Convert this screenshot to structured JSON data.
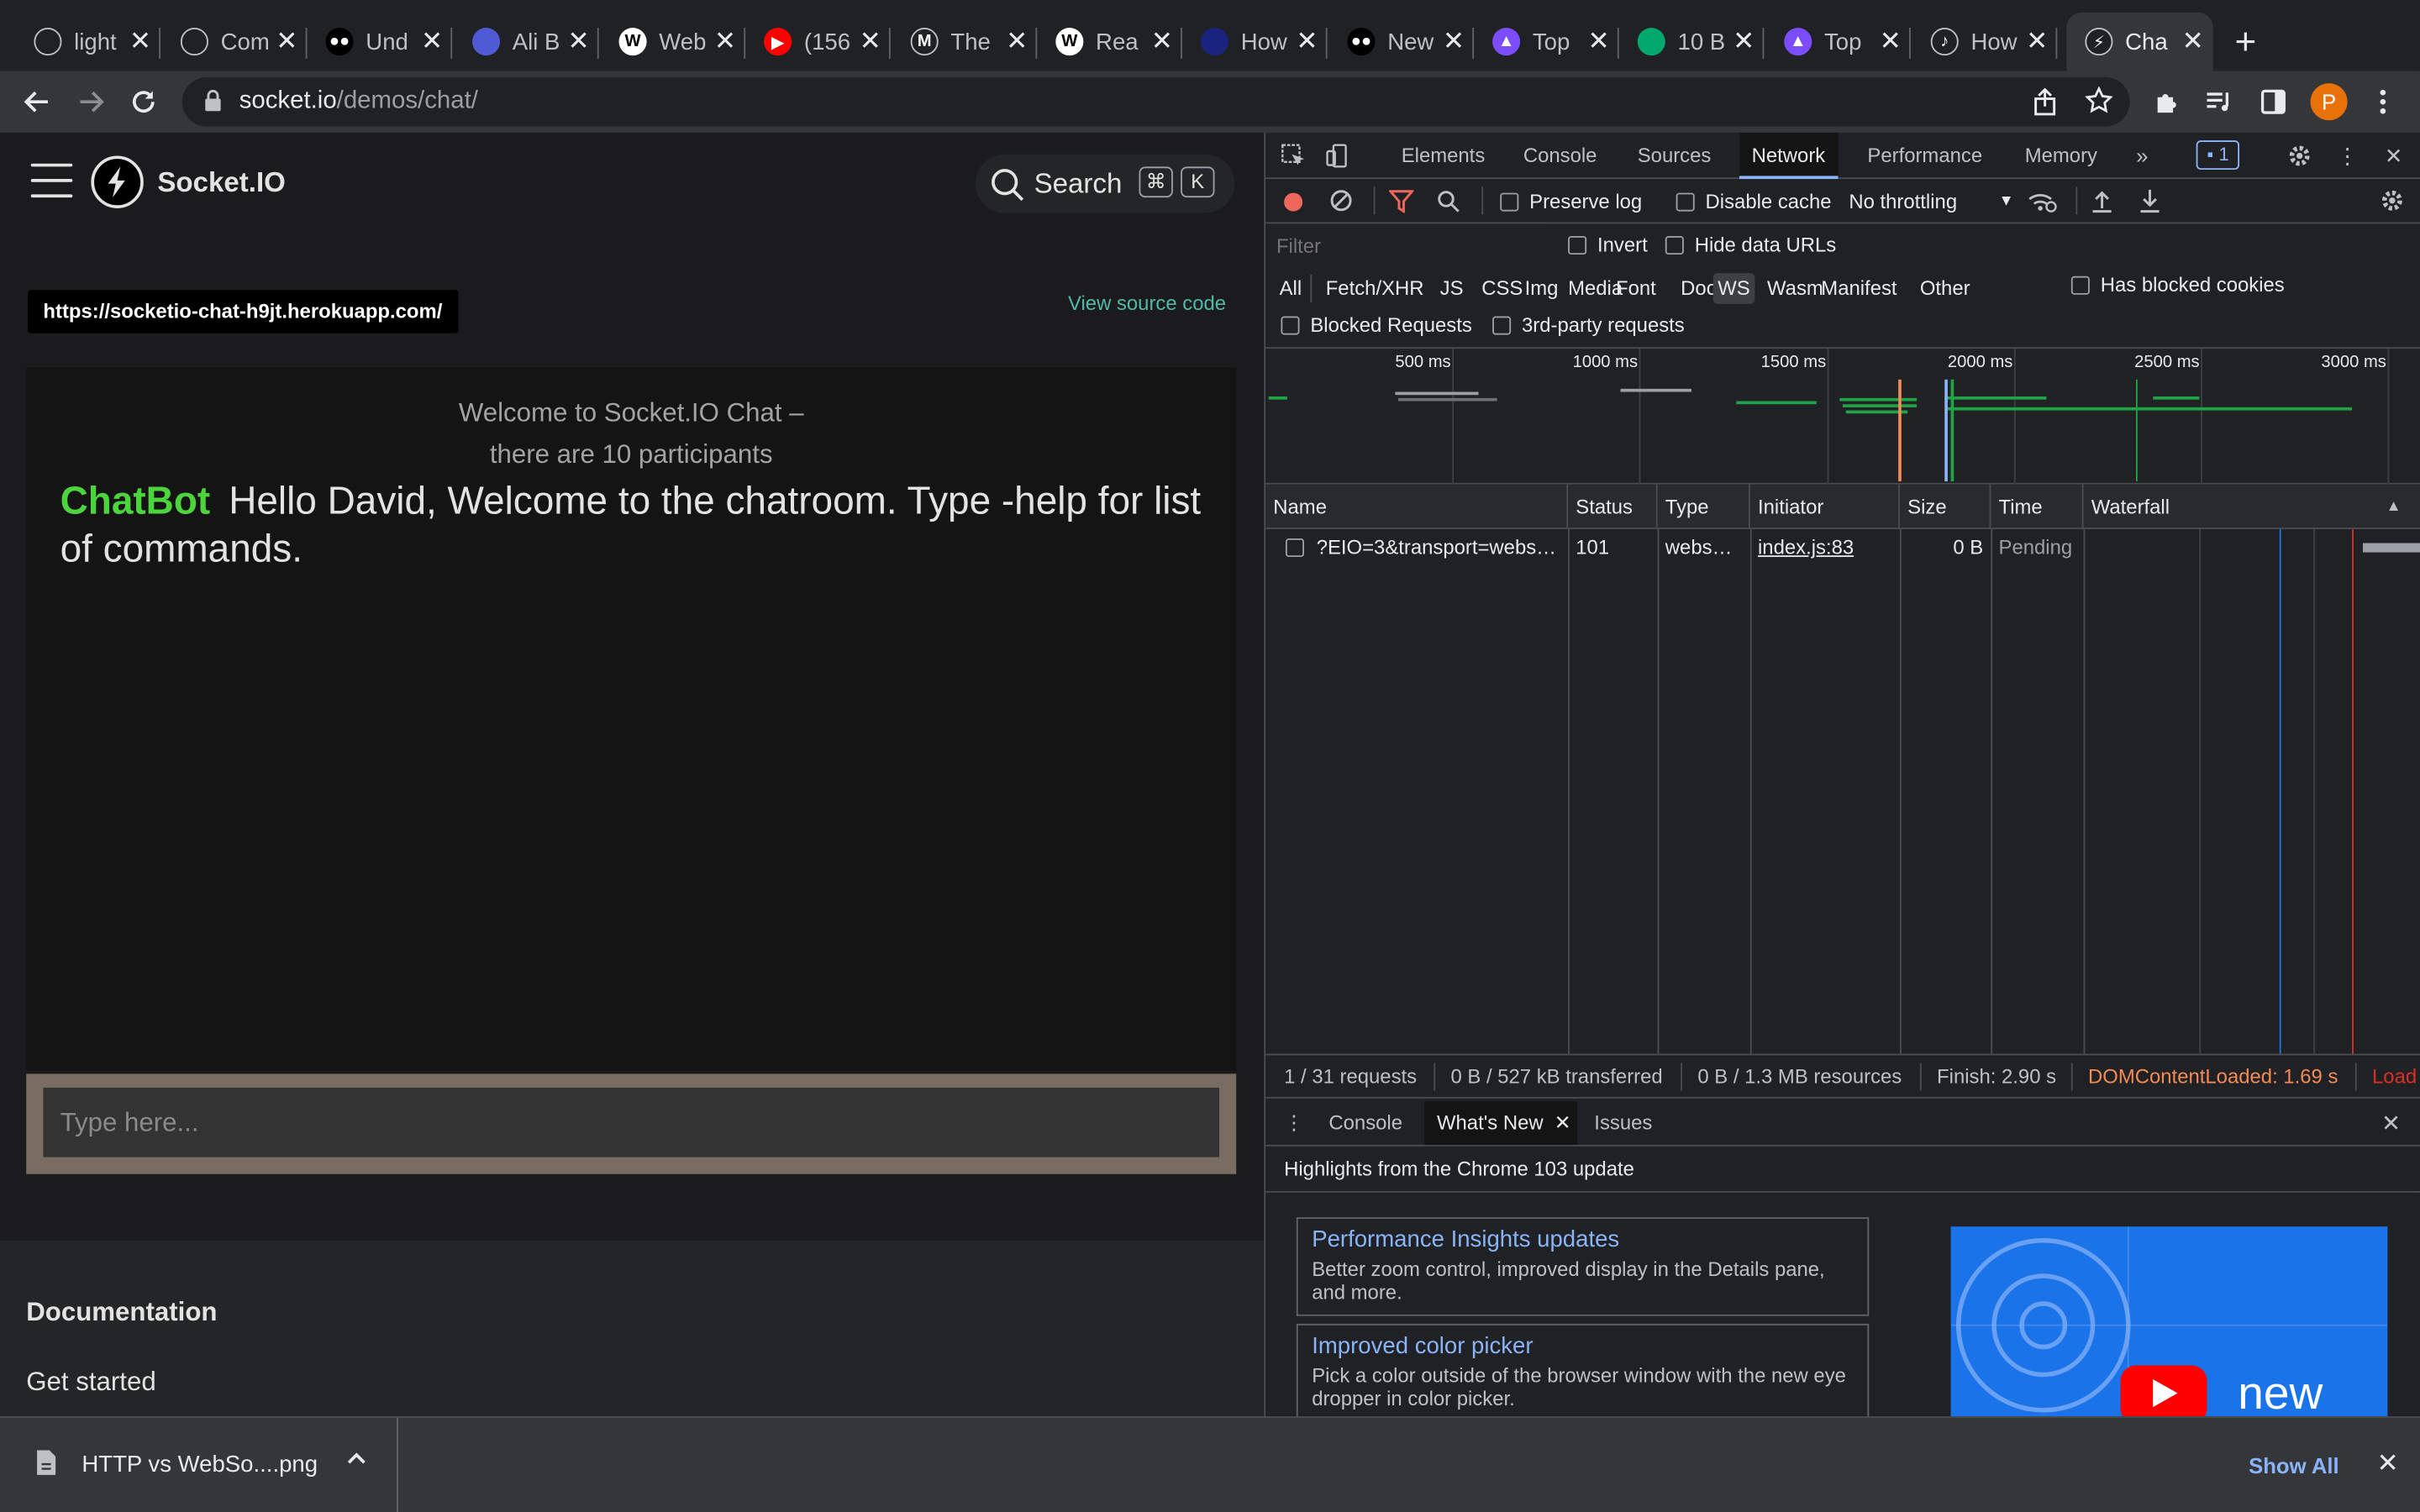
{
  "browser": {
    "tabs": [
      {
        "title": "light",
        "icon": "github-icon",
        "color": "#202124",
        "glyph": ""
      },
      {
        "title": "Com",
        "icon": "compass-icon",
        "color": "#202124",
        "glyph": ""
      },
      {
        "title": "Und",
        "icon": "medium-icon",
        "color": "#000000",
        "glyph": "●●"
      },
      {
        "title": "Ali B",
        "icon": "alibaba-icon",
        "color": "#4f5bd5",
        "glyph": ""
      },
      {
        "title": "Web",
        "icon": "wikipedia-icon",
        "color": "#ffffff",
        "glyph": "W"
      },
      {
        "title": "(156",
        "icon": "youtube-icon",
        "color": "#ff0000",
        "glyph": "▶"
      },
      {
        "title": "The",
        "icon": "m-logo-icon",
        "color": "#202124",
        "glyph": "M"
      },
      {
        "title": "Rea",
        "icon": "wikipedia-icon",
        "color": "#ffffff",
        "glyph": "W"
      },
      {
        "title": "How",
        "icon": "site-icon",
        "color": "#1a237e",
        "glyph": ""
      },
      {
        "title": "New",
        "icon": "medium-icon",
        "color": "#000000",
        "glyph": "●●"
      },
      {
        "title": "Top",
        "icon": "rocket-icon",
        "color": "#7c4dff",
        "glyph": "▲"
      },
      {
        "title": "10 B",
        "icon": "circle-logo-icon",
        "color": "#00a86b",
        "glyph": ""
      },
      {
        "title": "Top",
        "icon": "rocket-icon",
        "color": "#7c4dff",
        "glyph": "▲"
      },
      {
        "title": "How",
        "icon": "music-note-icon",
        "color": "#202124",
        "glyph": "♪"
      },
      {
        "title": "Cha",
        "icon": "socketio-icon",
        "color": "#202124",
        "glyph": "⚡"
      }
    ],
    "url_host": "socket.io",
    "url_path": "/demos/chat/",
    "profile_initial": "P"
  },
  "page": {
    "brand": "Socket.IO",
    "search_label": "Search",
    "kbd_cmd": "⌘",
    "kbd_k": "K",
    "demo_url": "https://socketio-chat-h9jt.herokuapp.com/",
    "view_source": "View source code",
    "welcome_line1": "Welcome to Socket.IO Chat –",
    "welcome_line2": "there are 10 participants",
    "message_user": "ChatBot",
    "message_text": "Hello David, Welcome to the chatroom. Type -help for list of commands.",
    "input_placeholder": "Type here...",
    "docs_heading": "Documentation",
    "docs_link": "Get started"
  },
  "devtools": {
    "tabs": [
      "Elements",
      "Console",
      "Sources",
      "Network",
      "Performance",
      "Memory"
    ],
    "active_tab": "Network",
    "issues_count": "1",
    "toolbar": {
      "preserve_log": "Preserve log",
      "disable_cache": "Disable cache",
      "throttling": "No throttling"
    },
    "filter": {
      "placeholder": "Filter",
      "invert": "Invert",
      "hide_data_urls": "Hide data URLs",
      "types": [
        "All",
        "Fetch/XHR",
        "JS",
        "CSS",
        "Img",
        "Media",
        "Font",
        "Doc",
        "WS",
        "Wasm",
        "Manifest",
        "Other"
      ],
      "active_type": "WS",
      "has_blocked_cookies": "Has blocked cookies",
      "blocked_requests": "Blocked Requests",
      "third_party": "3rd-party requests"
    },
    "overview_ticks": [
      "500 ms",
      "1000 ms",
      "1500 ms",
      "2000 ms",
      "2500 ms",
      "3000 ms"
    ],
    "columns": [
      "Name",
      "Status",
      "Type",
      "Initiator",
      "Size",
      "Time",
      "Waterfall"
    ],
    "rows": [
      {
        "name": "?EIO=3&transport=webs…",
        "status": "101",
        "type": "webs…",
        "initiator": "index.js:83",
        "size": "0 B",
        "time": "Pending"
      }
    ],
    "summary": {
      "requests": "1 / 31 requests",
      "transferred": "0 B / 527 kB transferred",
      "resources": "0 B / 1.3 MB resources",
      "finish": "Finish: 2.90 s",
      "dom_loaded": "DOMContentLoaded: 1.69 s",
      "load": "Load"
    },
    "drawer": {
      "tabs": [
        "Console",
        "What's New",
        "Issues"
      ],
      "active": "What's New",
      "heading": "Highlights from the Chrome 103 update",
      "cards": [
        {
          "title": "Performance Insights updates",
          "desc": "Better zoom control, improved display in the Details pane, and more."
        },
        {
          "title": "Improved color picker",
          "desc": "Pick a color outside of the browser window with the new eye dropper in color picker."
        }
      ],
      "promo_word": "new"
    }
  },
  "downloads": {
    "filename": "HTTP vs WebSo....png",
    "show_all": "Show All"
  },
  "colors": {
    "chatbot_green": "#4cd43d",
    "link_teal": "#4fb8a6",
    "devtools_accent": "#8ab4f8",
    "dom_loaded": "#f28b54"
  }
}
